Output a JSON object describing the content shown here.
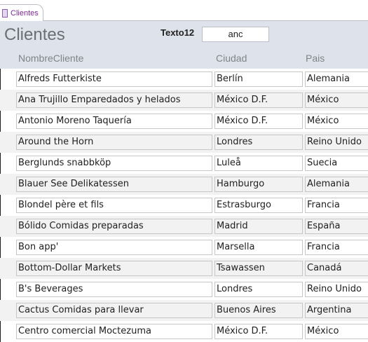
{
  "tab": {
    "label": "Clientes"
  },
  "header": {
    "title": "Clientes",
    "search_label": "Texto12",
    "search_value": "anc"
  },
  "columns": [
    "NombreCliente",
    "Ciudad",
    "Pais"
  ],
  "rows": [
    [
      "Alfreds Futterkiste",
      "Berlín",
      "Alemania"
    ],
    [
      "Ana Trujillo Emparedados y helados",
      "México D.F.",
      "México"
    ],
    [
      "Antonio Moreno Taquería",
      "México D.F.",
      "México"
    ],
    [
      "Around the Horn",
      "Londres",
      "Reino Unido"
    ],
    [
      "Berglunds snabbköp",
      "Luleå",
      "Suecia"
    ],
    [
      "Blauer See Delikatessen",
      "Hamburgo",
      "Alemania"
    ],
    [
      "Blondel père et fils",
      "Estrasburgo",
      "Francia"
    ],
    [
      "Bólido Comidas preparadas",
      "Madrid",
      "España"
    ],
    [
      "Bon app'",
      "Marsella",
      "Francia"
    ],
    [
      "Bottom-Dollar Markets",
      "Tsawassen",
      "Canadá"
    ],
    [
      "B's Beverages",
      "Londres",
      "Reino Unido"
    ],
    [
      "Cactus Comidas para llevar",
      "Buenos Aires",
      "Argentina"
    ],
    [
      "Centro comercial Moctezuma",
      "México D.F.",
      "México"
    ]
  ]
}
